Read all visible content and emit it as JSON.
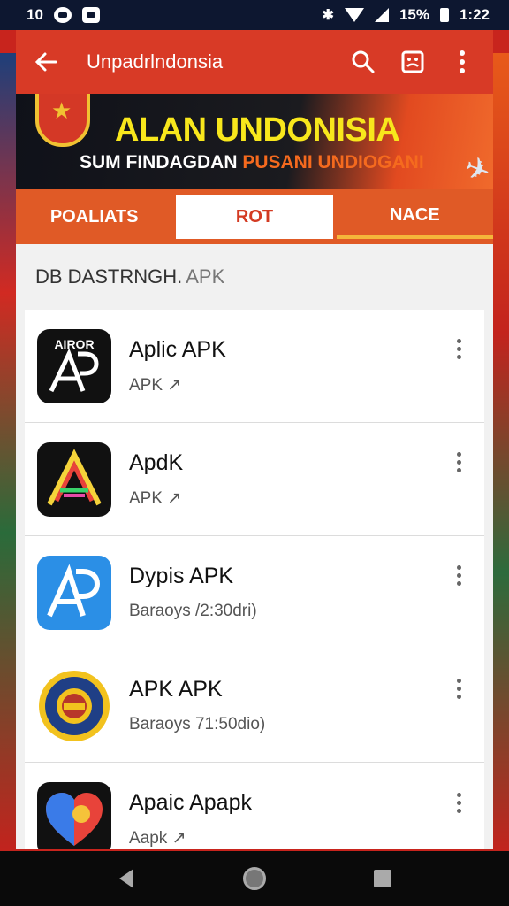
{
  "status_bar": {
    "time_left": "10",
    "battery_pct": "15%",
    "clock": "1:22"
  },
  "toolbar": {
    "title": "Unpadrlndonsia"
  },
  "banner": {
    "title": "ALAN UNDONISIA",
    "subtitle_a": "SUM FINDAGDAN ",
    "subtitle_b": "PUSANI UNDIOGANI"
  },
  "tabs": [
    "POALIATS",
    "ROT",
    "NACE"
  ],
  "section": {
    "title": "DB DASTRNGH.",
    "suffix": "APK"
  },
  "apps": [
    {
      "name": "Aplic APK",
      "sub": "APK ↗",
      "icon": "ap-logo-icon"
    },
    {
      "name": "ApdK",
      "sub": "APK ↗",
      "icon": "a-neon-icon"
    },
    {
      "name": "Dypis APK",
      "sub": "Baraoys /2:30dri)",
      "icon": "ap-blue-icon"
    },
    {
      "name": "APK APK",
      "sub": "Baraoys 71:50dio)",
      "icon": "seal-emblem-icon"
    },
    {
      "name": "Apaic Apapk",
      "sub": "Aapk ↗",
      "icon": "heart-icon"
    }
  ],
  "colors": {
    "toolbar": "#d83a26",
    "tab_bar": "#e05a26",
    "banner_title": "#f8e71c"
  }
}
